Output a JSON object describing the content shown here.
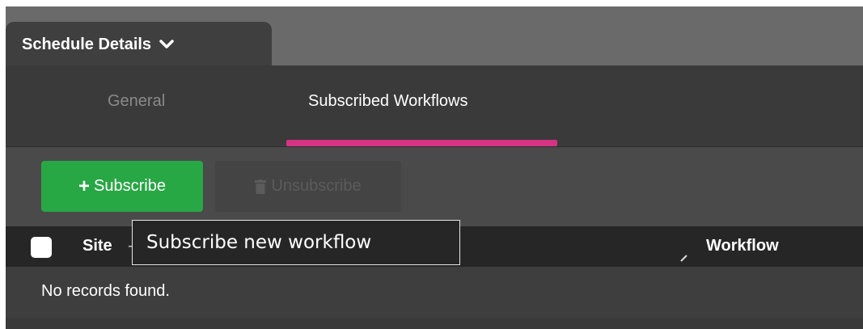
{
  "header": {
    "title": "Schedule Details"
  },
  "tabs": [
    {
      "label": "General",
      "active": false
    },
    {
      "label": "Subscribed Workflows",
      "active": true
    }
  ],
  "colors": {
    "accent": "#d63384",
    "primary_button": "#28a745",
    "panel": "#3a3a3a",
    "table_header": "#262626"
  },
  "toolbar": {
    "subscribe_label": "Subscribe",
    "unsubscribe_label": "Unsubscribe",
    "subscribe_icon": "plus-icon",
    "unsubscribe_icon": "trash-icon"
  },
  "table": {
    "columns": [
      "Site",
      "Workflow"
    ],
    "empty_message": "No records found."
  },
  "tooltip": {
    "text": "Subscribe new workflow"
  }
}
